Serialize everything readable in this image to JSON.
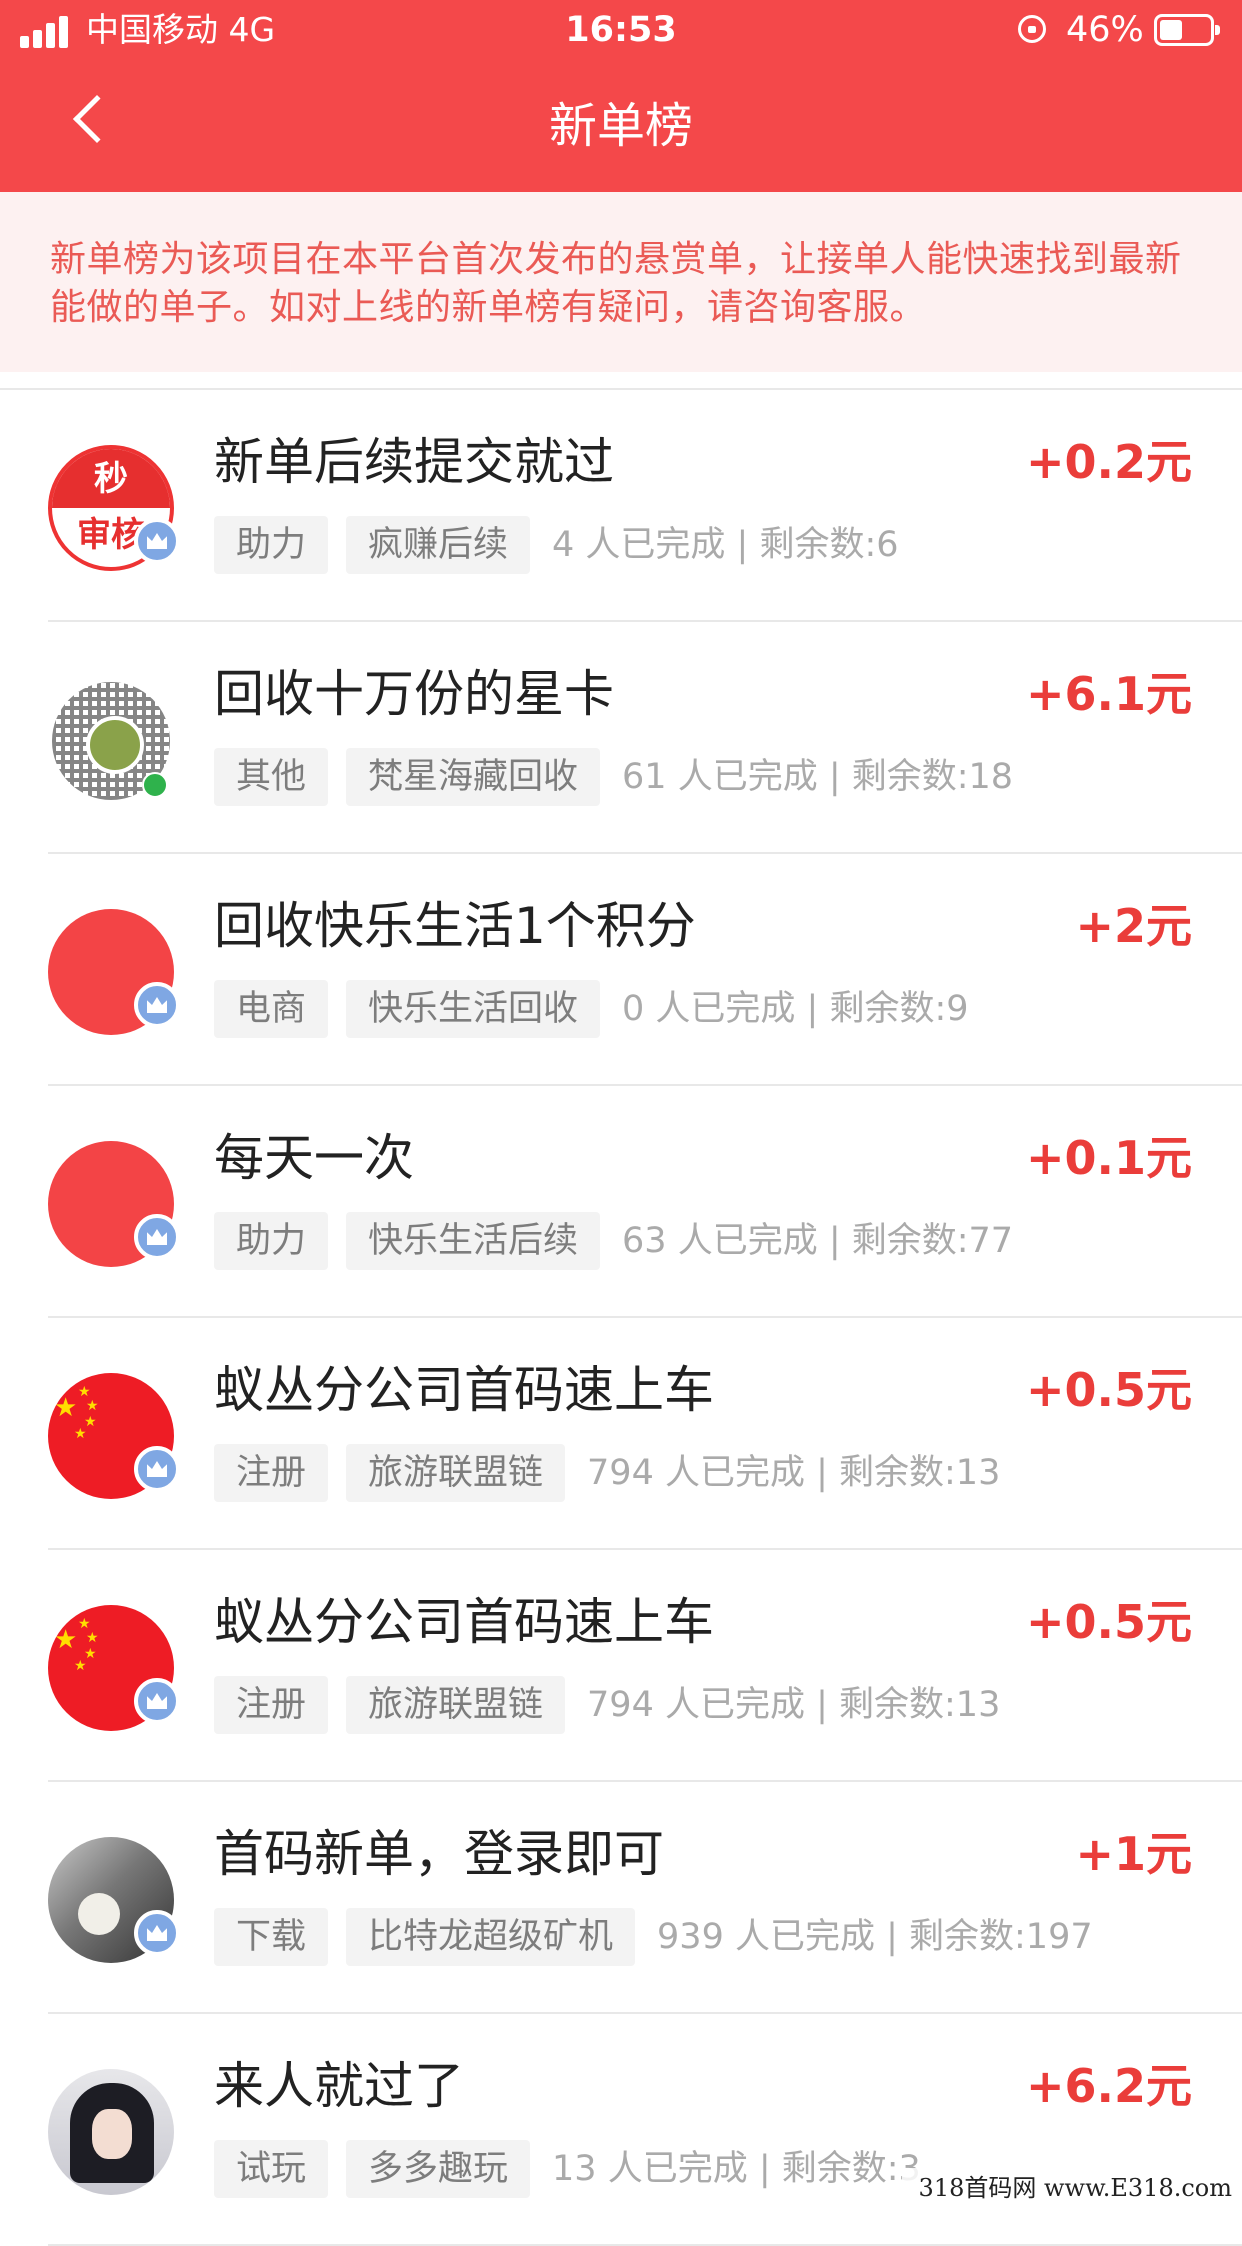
{
  "status_bar": {
    "carrier": "中国移动  4G",
    "time": "16:53",
    "battery": "46%",
    "battery_level": 0.46
  },
  "nav": {
    "title": "新单榜",
    "back_icon": "chevron-left-icon"
  },
  "notice": {
    "text": "新单榜为该项目在本平台首次发布的悬赏单，让接单人能快速找到最新能做的单子。如对上线的新单榜有疑问，请咨询客服。"
  },
  "items": [
    {
      "title": "新单后续提交就过",
      "price": "+0.2元",
      "tags": [
        "助力",
        "疯赚后续"
      ],
      "stats": "4 人已完成 | 剩余数:6",
      "avatar": "seal-avatar",
      "avatar_text": [
        "秒",
        "审核"
      ]
    },
    {
      "title": "回收十万份的星卡",
      "price": "+6.1元",
      "tags": [
        "其他",
        "梵星海藏回收"
      ],
      "stats": "61 人已完成 | 剩余数:18",
      "avatar": "qr-code-avatar"
    },
    {
      "title": "回收快乐生活1个积分",
      "price": "+2元",
      "tags": [
        "电商",
        "快乐生活回收"
      ],
      "stats": "0 人已完成 | 剩余数:9",
      "avatar": "red-circle-avatar"
    },
    {
      "title": "每天一次",
      "price": "+0.1元",
      "tags": [
        "助力",
        "快乐生活后续"
      ],
      "stats": "63 人已完成 | 剩余数:77",
      "avatar": "red-circle-avatar"
    },
    {
      "title": "蚁丛分公司首码速上车",
      "price": "+0.5元",
      "tags": [
        "注册",
        "旅游联盟链"
      ],
      "stats": "794 人已完成 | 剩余数:13",
      "avatar": "flag-avatar"
    },
    {
      "title": "蚁丛分公司首码速上车",
      "price": "+0.5元",
      "tags": [
        "注册",
        "旅游联盟链"
      ],
      "stats": "794 人已完成 | 剩余数:13",
      "avatar": "flag-avatar"
    },
    {
      "title": "首码新单，登录即可",
      "price": "+1元",
      "tags": [
        "下载",
        "比特龙超级矿机"
      ],
      "stats": "939 人已完成 | 剩余数:197",
      "avatar": "photo-avatar"
    },
    {
      "title": "来人就过了",
      "price": "+6.2元",
      "tags": [
        "试玩",
        "多多趣玩"
      ],
      "stats": "13 人已完成 | 剩余数:3",
      "avatar": "anime-avatar"
    }
  ],
  "watermark": "318首码网  www.E318.com",
  "colors": {
    "brand": "#f4484a",
    "price": "#ea3d3a",
    "notice_text": "#ea5a55",
    "notice_bg": "#fdf1f1"
  }
}
